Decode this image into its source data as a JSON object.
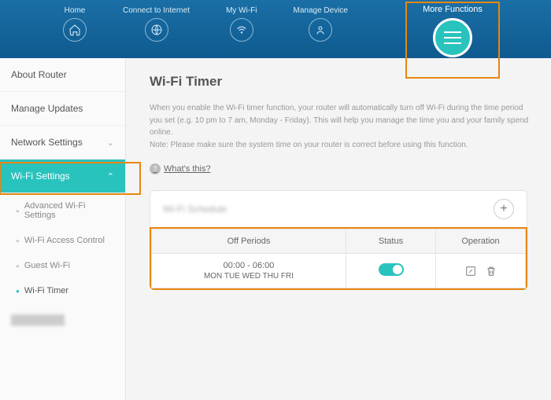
{
  "nav": {
    "home": "Home",
    "connect": "Connect to Internet",
    "wifi": "My Wi-Fi",
    "manage": "Manage Device",
    "more": "More Functions"
  },
  "sidebar": {
    "about": "About Router",
    "updates": "Manage Updates",
    "network": "Network Settings",
    "wifi": "Wi-Fi Settings",
    "sub": {
      "adv": "Advanced Wi-Fi Settings",
      "access": "Wi-Fi Access Control",
      "guest": "Guest Wi-Fi",
      "timer": "Wi-Fi Timer"
    }
  },
  "page": {
    "title": "Wi-Fi Timer",
    "desc1": "When you enable the Wi-Fi timer function, your router will automatically turn off Wi-Fi during the time period you set (e.g. 10 pm to 7 am, Monday - Friday). This will help you manage the time you and your family spend online.",
    "desc2": "Note: Please make sure the system time on your router is correct before using this function.",
    "whats": "What's this?"
  },
  "table": {
    "panel_title": "Wi-Fi Schedule",
    "h1": "Off Periods",
    "h2": "Status",
    "h3": "Operation",
    "row1": {
      "time": "00:00 - 06:00",
      "days": "MON TUE WED THU FRI"
    }
  }
}
